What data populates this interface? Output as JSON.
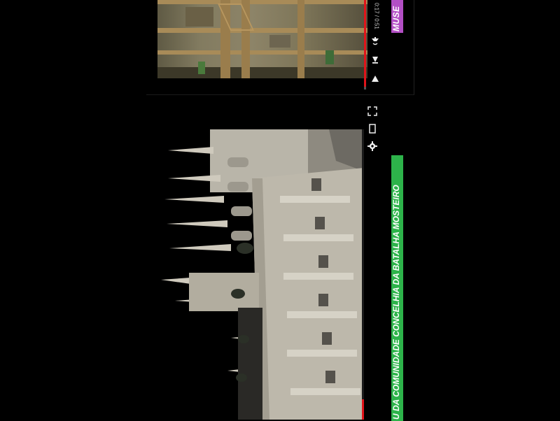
{
  "top_player": {
    "time": "0:17 / 0:51",
    "progress": 0.97
  },
  "main_player": {
    "progress": 0.93
  },
  "tags": {
    "museu": "MUSE",
    "caption": "U DA COMUNIDADE CONCELHIA DA BATALHA MOSTEIRO"
  },
  "colors": {
    "progress": "#e0141a",
    "tag_purple": "#b34fc5",
    "tag_green": "#2db34a"
  },
  "icons": [
    "fullscreen-icon",
    "theater-mode-icon",
    "settings-icon",
    "play-icon",
    "next-icon",
    "volume-icon"
  ]
}
